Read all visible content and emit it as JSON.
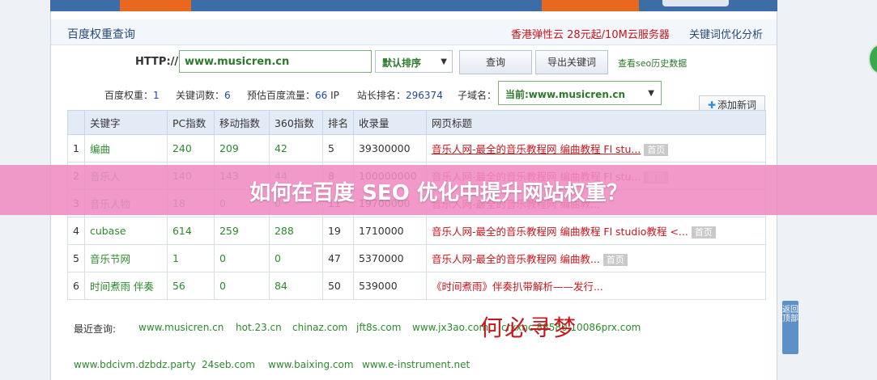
{
  "header": {
    "title": "百度权重查询",
    "ad_text": "香港弹性云 28元起/10M云服务器",
    "seo_link": "关键词优化分析"
  },
  "search": {
    "http_label": "HTTP://",
    "url_value": "www.musicren.cn",
    "sort_selected": "默认排序",
    "query_button": "查询",
    "export_button": "导出关键词",
    "history_link": "查看seo历史数据"
  },
  "stats": {
    "weight_label": "百度权重：",
    "weight_value": "1",
    "keywords_label": "关键词数：",
    "keywords_value": "6",
    "traffic_label": "预估百度流量：",
    "traffic_value": "66",
    "traffic_unit": "IP",
    "rank_label": "站长排名：",
    "rank_value": "296374",
    "subdomain_label": "子域名：",
    "subdomain_selected": "当前:www.musicren.cn",
    "add_button": "添加新词"
  },
  "table": {
    "columns": [
      "",
      "关键字",
      "PC指数",
      "移动指数",
      "360指数",
      "排名",
      "收录量",
      "网页标题"
    ],
    "rows": [
      {
        "idx": "1",
        "keyword": "编曲",
        "pc": "240",
        "mobile": "209",
        "s360": "42",
        "rank": "5",
        "indexed": "39300000",
        "title": "音乐人网-最全的音乐教程网 编曲教程 Fl stu...",
        "badge": "首页"
      },
      {
        "idx": "2",
        "keyword": "音乐人",
        "pc": "140",
        "mobile": "143",
        "s360": "44",
        "rank": "8",
        "indexed": "100000000",
        "title": "音乐人网-最全的音乐教程网 编曲教程 Fl stu...",
        "badge": "首页"
      },
      {
        "idx": "3",
        "keyword": "音乐人物",
        "pc": "18",
        "mobile": "0",
        "s360": "0",
        "rank": "11",
        "indexed": "19700000",
        "title": "音乐人网-最全的音乐教程网 编曲教...",
        "badge": ""
      },
      {
        "idx": "4",
        "keyword": "cubase",
        "pc": "614",
        "mobile": "259",
        "s360": "288",
        "rank": "19",
        "indexed": "1710000",
        "title": "音乐人网-最全的音乐教程网 编曲教程 Fl studio教程 <...",
        "badge": "首页"
      },
      {
        "idx": "5",
        "keyword": "音乐节网",
        "pc": "1",
        "mobile": "0",
        "s360": "0",
        "rank": "47",
        "indexed": "5370000",
        "title": "音乐人网-最全的音乐教程网 编曲教...",
        "badge": "首页"
      },
      {
        "idx": "6",
        "keyword": "时间煮雨 伴奏",
        "pc": "56",
        "mobile": "0",
        "s360": "84",
        "rank": "50",
        "indexed": "539000",
        "title": "《时间煮雨》伴奏扒带解析——发行...",
        "badge": ""
      }
    ]
  },
  "recent": {
    "label": "最近查询:",
    "links": [
      "www.musicren.cn",
      "hot.23.cn",
      "chinaz.com",
      "jft8s.com",
      "www.jx3ao.com",
      "crxxnc.88580.10086prx.com",
      "www.bdcivm.dzbdz.party",
      "24seb.com",
      "www.baixing.com",
      "www.e-instrument.net"
    ]
  },
  "watermark": "何必寻梦",
  "side_tab": "返回顶部",
  "banner": "如何在百度 SEO 优化中提升网站权重？"
}
